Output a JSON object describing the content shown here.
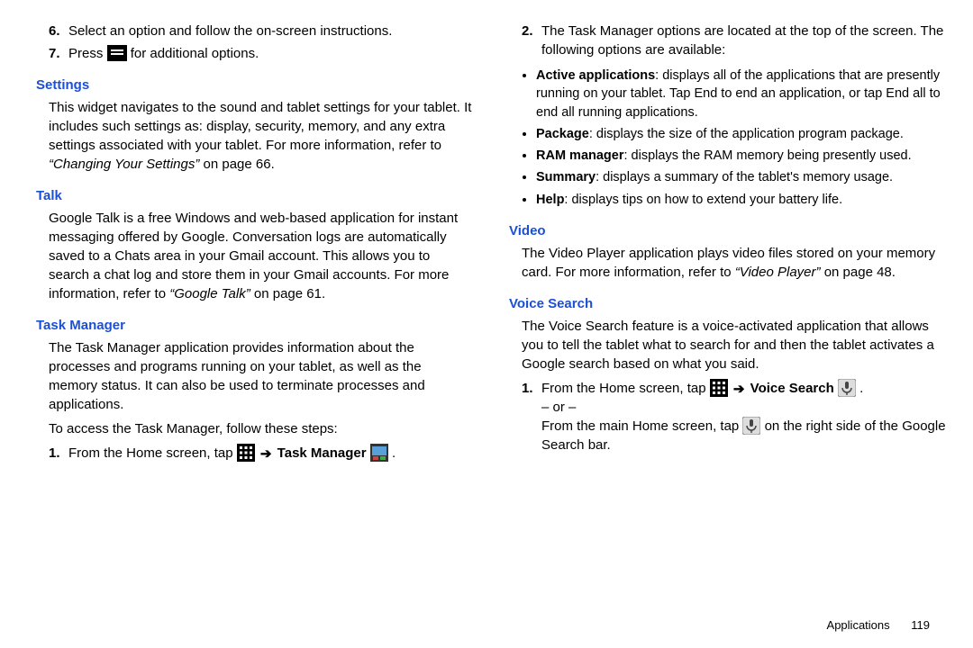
{
  "left": {
    "olStart": [
      {
        "n": "6.",
        "text": "Select an option and follow the on-screen instructions."
      },
      {
        "n": "7.",
        "pre": "Press ",
        "post": " for additional options."
      }
    ],
    "settings": {
      "heading": "Settings",
      "body_pre": "This widget navigates to the sound and tablet settings for your tablet. It includes such settings as: display, security, memory, and any extra settings associated with your tablet. For more information, refer to ",
      "body_ref": "“Changing Your Settings” ",
      "body_post": " on page 66."
    },
    "talk": {
      "heading": "Talk",
      "body_pre": "Google Talk is a free Windows and web-based application for instant messaging offered by Google. Conversation logs are automatically saved to a Chats area in your Gmail account. This allows you to search a chat log and store them in your Gmail accounts. For more information, refer to ",
      "body_ref": "“Google Talk” ",
      "body_post": " on page 61."
    },
    "taskmgr": {
      "heading": "Task Manager",
      "p1": "The Task Manager application provides information about the processes and programs running on your tablet, as well as the memory status. It can also be used to terminate processes and applications.",
      "p2": "To access the Task Manager, follow these steps:",
      "step1_n": "1.",
      "step1_pre": "From the Home screen, tap ",
      "step1_bold": "Task Manager",
      "step1_post": "."
    }
  },
  "right": {
    "step2_n": "2.",
    "step2_text": "The Task Manager options are located at the top of the screen. The following options are available:",
    "bullets": [
      {
        "bold": "Active applications",
        "rest": ": displays all of the applications that are presently running on your tablet. Tap End to end an application, or tap End all to end all running applications."
      },
      {
        "bold": "Package",
        "rest": ": displays the size of the application program package."
      },
      {
        "bold": "RAM manager",
        "rest": ": displays the RAM memory being presently used."
      },
      {
        "bold": "Summary",
        "rest": ": displays a summary of the tablet's memory usage."
      },
      {
        "bold": "Help",
        "rest": ": displays tips on how to extend your battery life."
      }
    ],
    "video": {
      "heading": "Video",
      "pre": "The Video Player application plays video files stored on your memory card. For more information, refer to ",
      "ref": "“Video Player” ",
      "post": " on page 48."
    },
    "voice": {
      "heading": "Voice Search",
      "p1": "The Voice Search feature is a voice-activated application that allows you to tell the tablet what to search for and then the tablet activates a Google search based on what you said.",
      "step1_n": "1.",
      "step1_pre": "From the Home screen, tap ",
      "step1_bold": "Voice Search",
      "step1_post": ".",
      "or": "– or –",
      "p2_pre": "From the main Home screen, tap ",
      "p2_post": " on the right side of the Google Search bar."
    }
  },
  "footer": {
    "label": "Applications",
    "page": "119"
  }
}
